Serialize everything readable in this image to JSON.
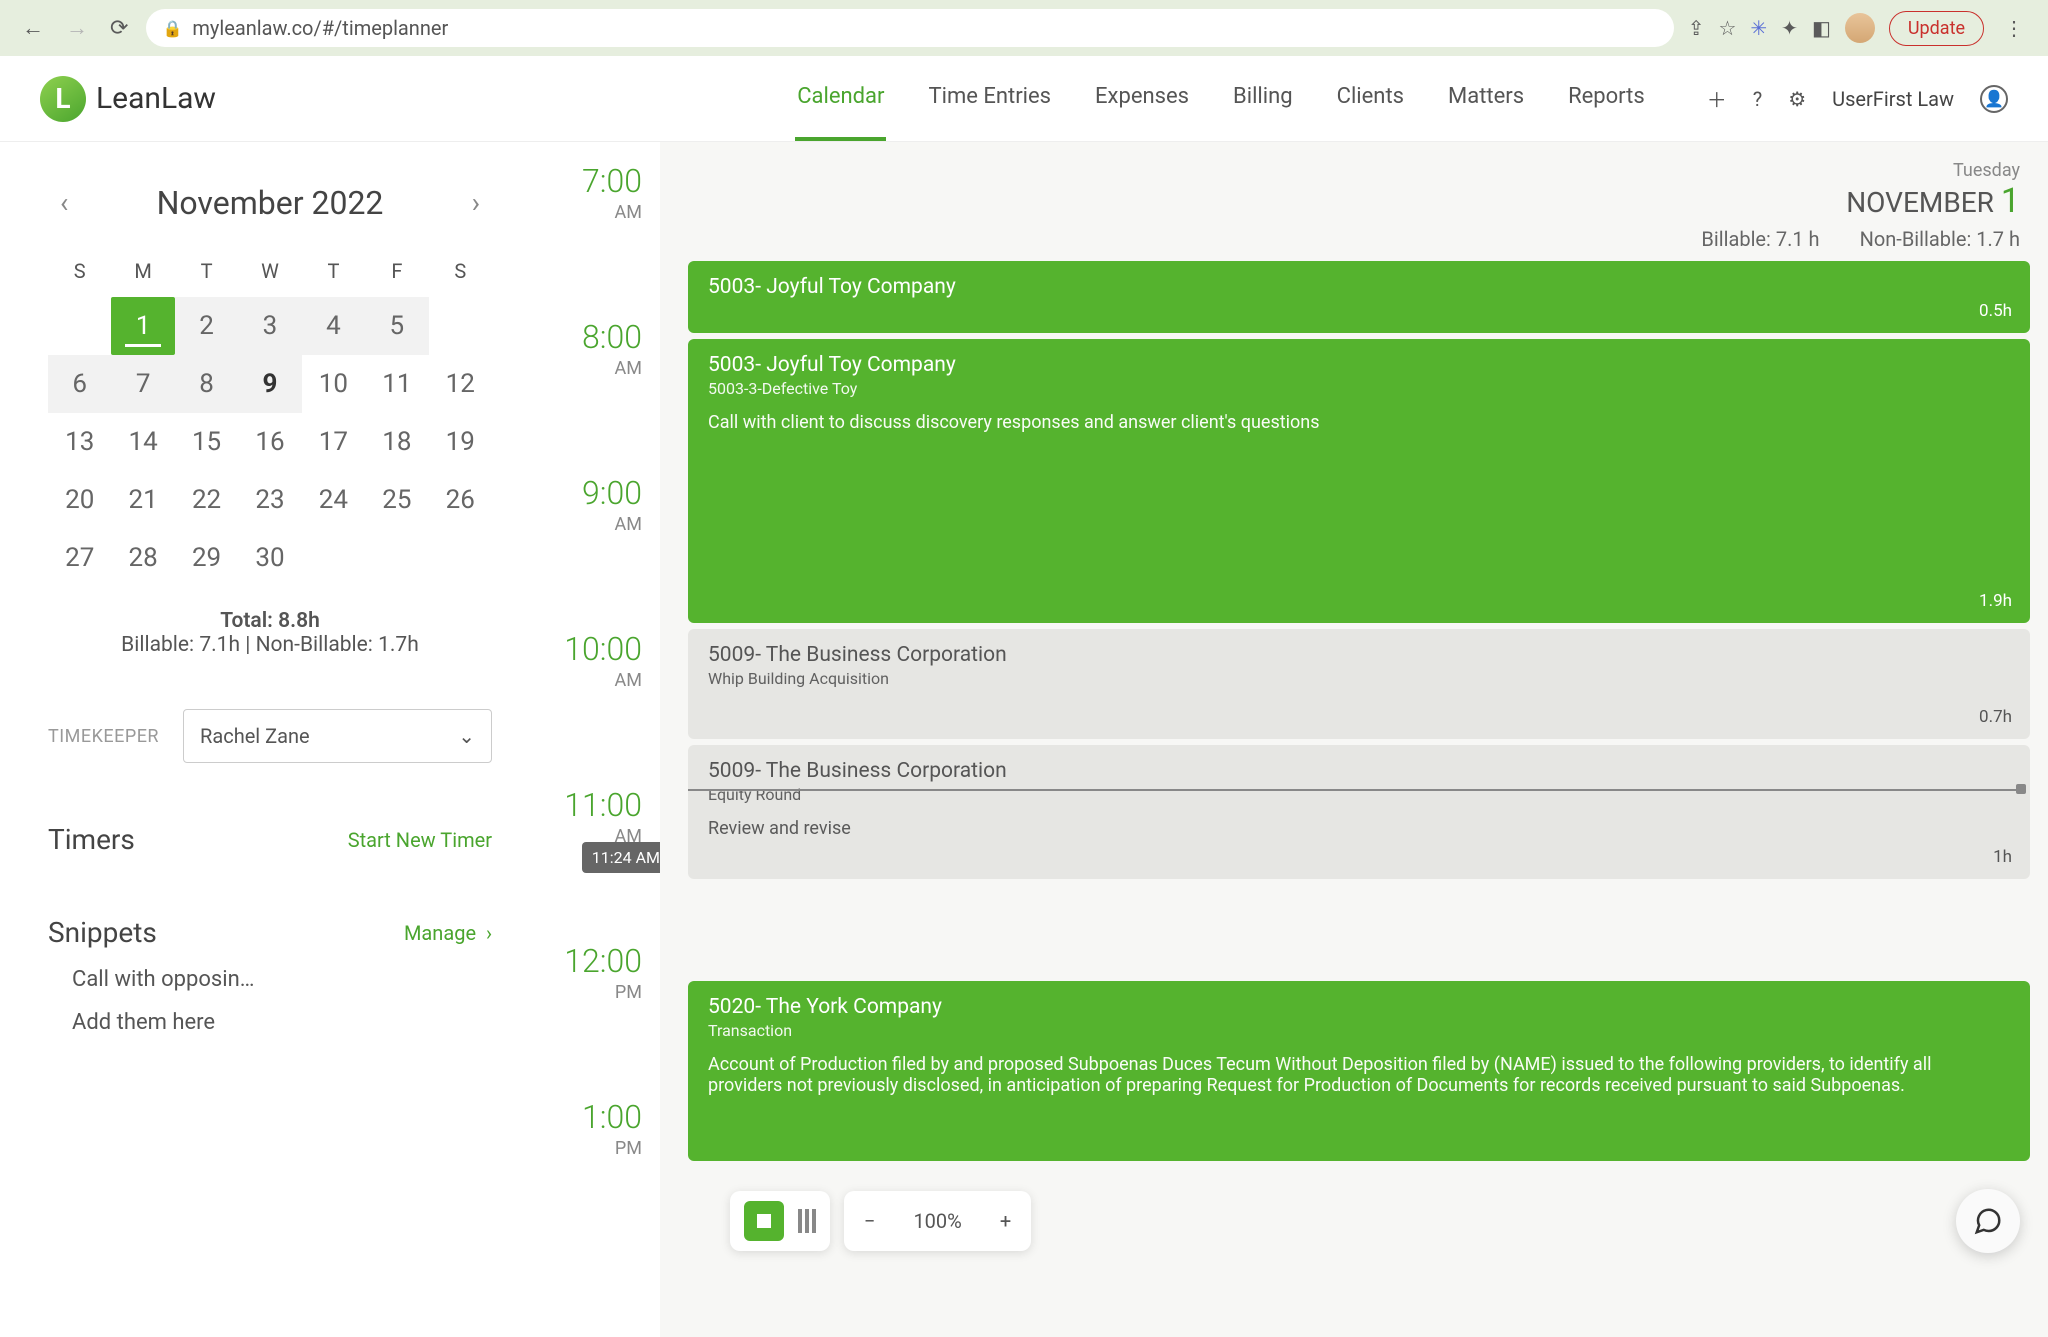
{
  "browser": {
    "url": "myleanlaw.co/#/timeplanner",
    "update_label": "Update"
  },
  "brand": "LeanLaw",
  "nav": {
    "items": [
      "Calendar",
      "Time Entries",
      "Expenses",
      "Billing",
      "Clients",
      "Matters",
      "Reports"
    ],
    "active": 0,
    "firm": "UserFirst Law"
  },
  "calendar": {
    "title": "November 2022",
    "dow": [
      "S",
      "M",
      "T",
      "W",
      "T",
      "F",
      "S"
    ],
    "weeks": [
      [
        "",
        "1",
        "2",
        "3",
        "4",
        "5",
        ""
      ],
      [
        "6",
        "7",
        "8",
        "9",
        "10",
        "11",
        "12"
      ],
      [
        "13",
        "14",
        "15",
        "16",
        "17",
        "18",
        "19"
      ],
      [
        "20",
        "21",
        "22",
        "23",
        "24",
        "25",
        "26"
      ],
      [
        "27",
        "28",
        "29",
        "30",
        "",
        "",
        ""
      ]
    ],
    "selected": "1",
    "bold_days": [
      "9"
    ],
    "totals": {
      "total": "Total: 8.8h",
      "breakdown": "Billable: 7.1h | Non-Billable: 1.7h"
    }
  },
  "timekeeper": {
    "label": "TIMEKEEPER",
    "value": "Rachel Zane"
  },
  "timers": {
    "heading": "Timers",
    "start": "Start New Timer"
  },
  "snippets": {
    "heading": "Snippets",
    "manage": "Manage",
    "items": [
      "Call with opposin…",
      "Add them here"
    ]
  },
  "times": [
    {
      "hr": "7:00",
      "ap": "AM"
    },
    {
      "hr": "8:00",
      "ap": "AM"
    },
    {
      "hr": "9:00",
      "ap": "AM"
    },
    {
      "hr": "10:00",
      "ap": "AM"
    },
    {
      "hr": "11:00",
      "ap": "AM"
    },
    {
      "hr": "12:00",
      "ap": "PM"
    },
    {
      "hr": "1:00",
      "ap": "PM"
    }
  ],
  "now": "11:24 AM",
  "day": {
    "dow": "Tuesday",
    "month": "NOVEMBER",
    "num": "1",
    "billable": "Billable: 7.1 h",
    "nonbillable": "Non-Billable: 1.7 h"
  },
  "events": [
    {
      "title": "5003- Joyful Toy Company",
      "sub": "",
      "desc": "",
      "hrs": "0.5h",
      "color": "green"
    },
    {
      "title": "5003- Joyful Toy Company",
      "sub": "5003-3-Defective Toy",
      "desc": "Call with client to discuss discovery responses and answer client's questions",
      "hrs": "1.9h",
      "color": "green"
    },
    {
      "title": "5009- The Business Corporation",
      "sub": "Whip Building Acquisition",
      "desc": "",
      "hrs": "0.7h",
      "color": "grey"
    },
    {
      "title": "5009- The Business Corporation",
      "sub": "Equity Round",
      "desc": "Review and revise",
      "hrs": "1h",
      "color": "grey"
    },
    {
      "title": "5020- The York Company",
      "sub": "Transaction",
      "desc": "Account of Production filed by and proposed Subpoenas Duces Tecum Without Deposition filed by (NAME) issued to the following providers, to identify all providers not previously disclosed, in anticipation of preparing Request for Production of Documents for records received pursuant to said Subpoenas.",
      "hrs": "",
      "color": "green"
    }
  ],
  "zoom": "100%"
}
